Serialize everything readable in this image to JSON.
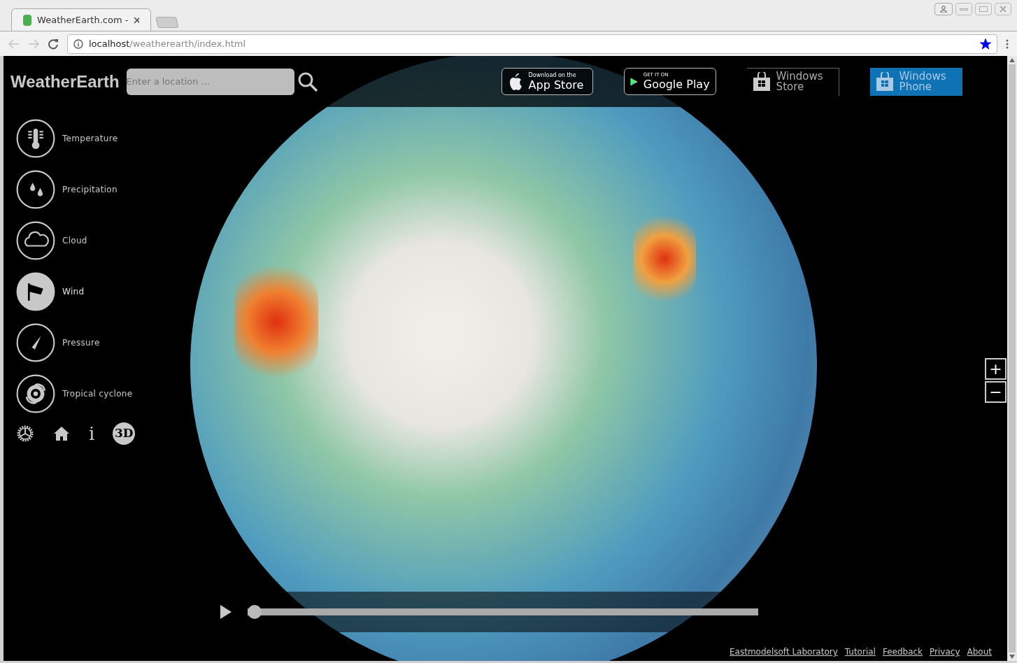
{
  "browser": {
    "tab_title": "WeatherEarth.com -",
    "url_host": "localhost",
    "url_path": "/weatherearth/index.html",
    "bookmarked": true
  },
  "app": {
    "title": "WeatherEarth",
    "search": {
      "placeholder": "Enter a location …"
    },
    "store_badges": [
      {
        "kind": "apple",
        "small": "Download on the",
        "big": "App Store"
      },
      {
        "kind": "google",
        "small": "GET IT ON",
        "big": "Google Play"
      },
      {
        "kind": "windows",
        "small": "Windows",
        "big": "Store"
      },
      {
        "kind": "windowsphone",
        "small": "Windows",
        "big": "Phone"
      }
    ],
    "layers": [
      {
        "kind": "temperature",
        "label": "Temperature",
        "selected": false
      },
      {
        "kind": "precipitation",
        "label": "Precipitation",
        "selected": false
      },
      {
        "kind": "cloud",
        "label": "Cloud",
        "selected": false
      },
      {
        "kind": "wind",
        "label": "Wind",
        "selected": true
      },
      {
        "kind": "pressure",
        "label": "Pressure",
        "selected": false
      },
      {
        "kind": "cyclone",
        "label": "Tropical cyclone",
        "selected": false
      }
    ],
    "tools": [
      {
        "kind": "settings"
      },
      {
        "kind": "home"
      },
      {
        "kind": "info",
        "label": "i"
      },
      {
        "kind": "globe3d",
        "label": "3D"
      }
    ],
    "zoom": {
      "in": "+",
      "out": "−"
    },
    "timeline": {
      "level": 0
    },
    "footer_links": [
      "Eastmodelsoft Laboratory",
      "Tutorial",
      "Feedback",
      "Privacy",
      "About"
    ]
  }
}
